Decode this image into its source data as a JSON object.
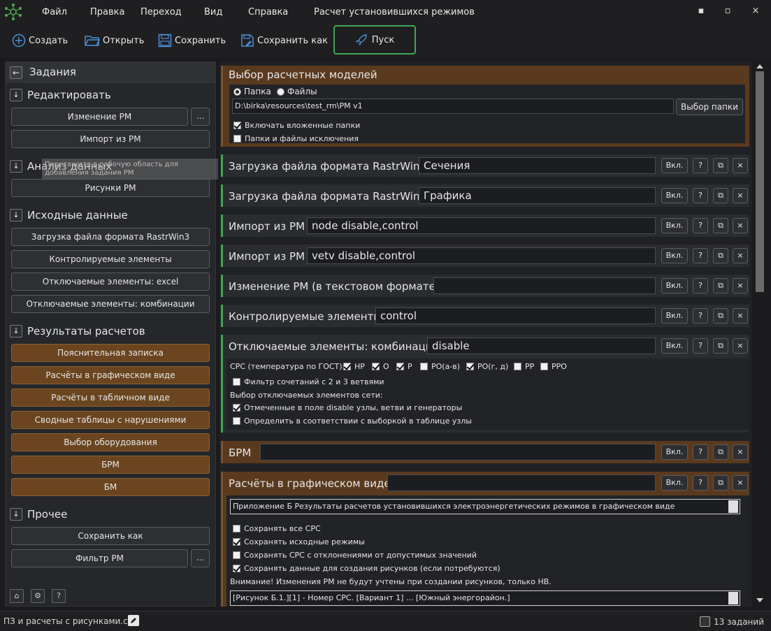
{
  "app": {
    "title": "Расчет установившихся режимов",
    "menu": [
      "Файл",
      "Правка",
      "Переход",
      "Вид",
      "Справка"
    ],
    "window_controls": {
      "minimize": "▪",
      "maximize": "▫",
      "close": "×"
    }
  },
  "toolbar": {
    "create": "Создать",
    "open": "Открыть",
    "save": "Сохранить",
    "save_as": "Сохранить как",
    "run": "Пуск"
  },
  "sidebar": {
    "back": "←",
    "title": "Задания",
    "arrow": "↓",
    "sections": {
      "edit": {
        "label": "Редактировать",
        "items": [
          "Изменение РМ",
          "Импорт из РМ"
        ]
      },
      "analysis": {
        "label": "Анализ данных",
        "items": [
          "Рисунки РМ"
        ]
      },
      "source": {
        "label": "Исходные данные",
        "items": [
          "Загрузка файла формата RastrWin3",
          "Контролируемые элементы",
          "Отключаемые элементы: excel",
          "Отключаемые элементы: комбинации"
        ]
      },
      "results": {
        "label": "Результаты расчетов",
        "items": [
          "Пояснительная записка",
          "Расчёты в графическом виде",
          "Расчёты в табличном виде",
          "Сводные таблицы с нарушениями",
          "Выбор оборудования",
          "БРМ",
          "БМ"
        ]
      },
      "other": {
        "label": "Прочее",
        "items": [
          "Сохранить как",
          "Фильтр РМ"
        ]
      }
    },
    "dots": "...",
    "drag_ghost": "Перетащите в рабочую область для добавления задания РМ",
    "footer_icons": [
      "home-icon",
      "settings-icon",
      "help-icon"
    ],
    "footer_glyphs": [
      "⌂",
      "⚙",
      "?"
    ]
  },
  "model_select": {
    "title": "Выбор расчетных моделей",
    "radio_folder": "Папка",
    "radio_files": "Файлы",
    "path": "D:\\birka\\resources\\test_rm\\РМ v1",
    "choose_folder": "Выбор папки",
    "include_nested": "Включать вложенные папки",
    "exclusions": "Папки и файлы исключения"
  },
  "panel_buttons": {
    "on": "Вкл.",
    "help": "?",
    "copy": "⧉",
    "close": "×"
  },
  "panels": [
    {
      "title": "Загрузка файла формата RastrWin3",
      "value": "Сечения"
    },
    {
      "title": "Загрузка файла формата RastrWin3",
      "value": "Графика"
    },
    {
      "title": "Импорт из РМ",
      "value": "node disable,control"
    },
    {
      "title": "Импорт из РМ",
      "value": "vetv disable,control"
    },
    {
      "title": "Изменение РМ (в текстовом формате)",
      "value": ""
    },
    {
      "title": "Контролируемые элементы",
      "value": "control"
    },
    {
      "title": "Отключаемые элементы: комбинации",
      "value": "disable"
    }
  ],
  "combinations": {
    "src_label": "СРС (температура по ГОСТ):",
    "src_options": [
      {
        "label": "НР",
        "checked": true
      },
      {
        "label": "О",
        "checked": true
      },
      {
        "label": "Р",
        "checked": true
      },
      {
        "label": "РО(а-в)",
        "checked": false
      },
      {
        "label": "РО(г, д)",
        "checked": true
      },
      {
        "label": "РР",
        "checked": false
      },
      {
        "label": "РРО",
        "checked": false
      }
    ],
    "filter": "Фильтр сочетаний с 2 и 3 ветвями",
    "select_label": "Выбор отключаемых элементов сети:",
    "opt_marked": "Отмеченные в поле disable узлы, ветви и генераторы",
    "opt_table": "Определить в соответствии с выборкой в таблице узлы"
  },
  "brm": {
    "title": "БРМ",
    "value": ""
  },
  "graphic": {
    "title": "Расчёты в графическом виде",
    "value": "",
    "caption": "Приложение Б Результаты расчетов установившихся электроэнергетических режимов в графическом виде",
    "save_all": "Сохранять все СРС",
    "save_source": "Сохранять исходные режимы",
    "save_deviation": "Сохранять СРС с отклонениями от допустимых значений",
    "save_data": "Сохранять данные для создания рисунков (если потребуются)",
    "warning": "Внимание! Изменения РМ не будут учтены при создании рисунков, только НВ.",
    "figure_template": "[Рисунок Б.1.][1] - Номер СРС. [Вариант 1] ... [Южный энергорайон.]"
  },
  "status": {
    "file": "ПЗ и расчеты с рисунками.calc",
    "tasks": "13 заданий"
  },
  "colors": {
    "accent_green": "#3fa653",
    "brown": "#6a4520",
    "panel_brown": "#5a3a1e"
  }
}
